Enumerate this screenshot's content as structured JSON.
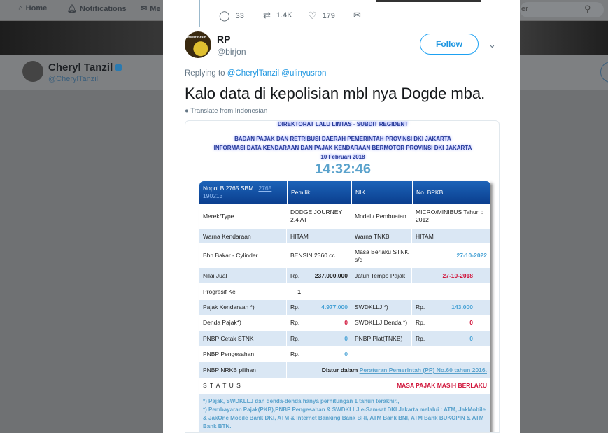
{
  "nav": {
    "items": [
      {
        "label": "Home",
        "icon": "home-icon"
      },
      {
        "label": "Notifications",
        "icon": "bell-icon"
      },
      {
        "label": "Me",
        "icon": "mail-icon"
      }
    ],
    "search_placeholder": "er"
  },
  "profile": {
    "name": "Cheryl Tanzil",
    "handle": "@CherylTanzil",
    "verified": true
  },
  "prev_tweet": {
    "replies": "33",
    "retweets": "1.4K",
    "likes": "179"
  },
  "tweet": {
    "name": "RP",
    "handle": "@birjon",
    "follow_label": "Follow",
    "replying_label": "Replying to",
    "replying_to": [
      "@CherylTanzil",
      "@ulinyusron"
    ],
    "text": "Kalo data di kepolisian mbl nya Dogde mba.",
    "translate": "Translate from Indonesian",
    "avatar_text": "Insert Brain"
  },
  "doc": {
    "header": [
      "DIREKTORAT LALU LINTAS - SUBDIT REGIDENT",
      "BADAN PAJAK DAN RETRIBUSI DAERAH PEMERINTAH PROVINSI DKI JAKARTA",
      "INFORMASI DATA KENDARAAN DAN PAJAK KENDARAAN BERMOTOR PROVINSI DKI JAKARTA",
      "10 Februari 2018"
    ],
    "time": "14:32:46",
    "th": {
      "nopol": "Nopol B 2765 SBM",
      "link": "2765 190213",
      "pemilik": "Pemilik",
      "nik": "NIK",
      "bpkb": "No. BPKB"
    },
    "rows": {
      "merek": [
        "Merek/Type",
        "DODGE  JOURNEY 2.4 AT",
        "Model / Pembuatan",
        "MICRO/MINIBUS  Tahun : 2012"
      ],
      "warna": [
        "Warna Kendaraan",
        "HITAM",
        "Warna TNKB",
        "HITAM"
      ],
      "bbm": [
        "Bhn Bakar - Cylinder",
        "BENSIN  2360 cc",
        "Masa Berlaku STNK s/d",
        "27-10-2022"
      ],
      "nilai": [
        "Nilai Jual",
        "Rp.",
        "237.000.000",
        "Jatuh Tempo Pajak",
        "27-10-2018"
      ],
      "progresif": [
        "Progresif Ke",
        "1"
      ],
      "pajak": [
        "Pajak Kendaraan *)",
        "Rp.",
        "4.977.000",
        "SWDKLLJ *)",
        "Rp.",
        "143.000"
      ],
      "denda": [
        "Denda Pajak*)",
        "Rp.",
        "0",
        "SWDKLLJ Denda *)",
        "Rp.",
        "0"
      ],
      "cetak": [
        "PNBP Cetak STNK",
        "Rp.",
        "0",
        "PNBP Plat(TNKB)",
        "Rp.",
        "0"
      ],
      "pengesahan": [
        "PNBP Pengesahan",
        "Rp.",
        "0"
      ],
      "nrkb": [
        "PNBP NRKB pilihan",
        "Diatur dalam",
        "Peraturan Pemerintah (PP) No.60 tahun 2016."
      ],
      "status": [
        "S T A T U S",
        "MASA PAJAK MASIH BERLAKU"
      ]
    },
    "notes": [
      "*) Pajak, SWDKLLJ dan denda-denda hanya perhitungan 1 tahun terakhir.,",
      "*) Pembayaran Pajak(PKB),PNBP Pengesahan & SWDKLLJ e-Samsat DKI Jakarta melalui : ATM, JakMobile & JakOne Mobile Bank DKI, ATM & Internet Banking Bank BRI, ATM Bank BNI, ATM Bank BUKOPIN & ATM Bank BTN."
    ]
  },
  "colors": {
    "accent": "#1da1f2",
    "table_header": "#0b3f8f",
    "row_alt": "#dae7f4",
    "red": "#d0143a"
  }
}
